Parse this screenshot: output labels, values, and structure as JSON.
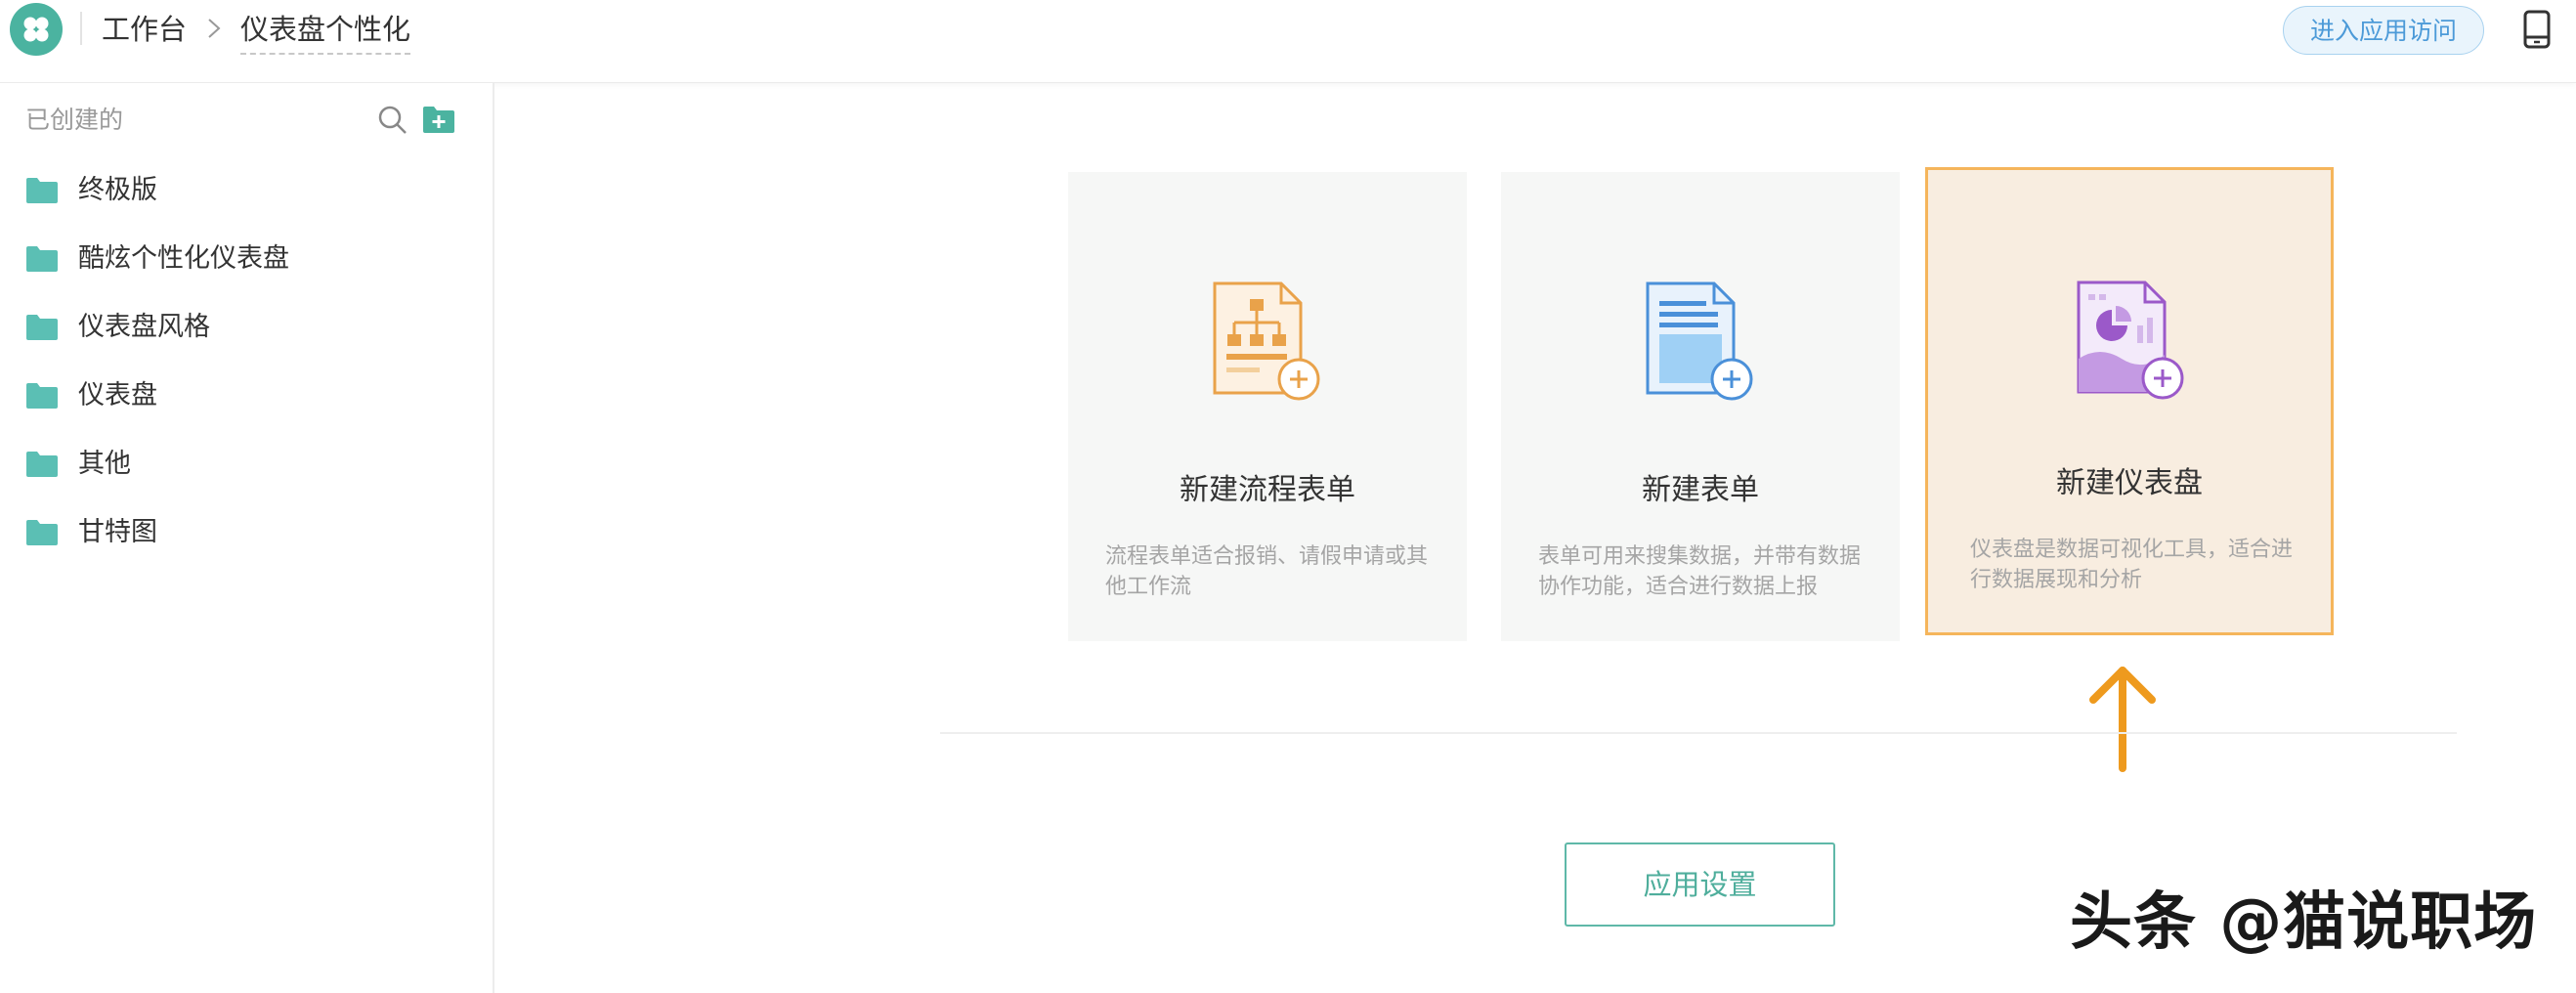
{
  "header": {
    "breadcrumb_root": "工作台",
    "breadcrumb_current": "仪表盘个性化",
    "visit_button_label": "进入应用访问"
  },
  "sidebar": {
    "title": "已创建的",
    "items": [
      {
        "label": "终极版"
      },
      {
        "label": "酷炫个性化仪表盘"
      },
      {
        "label": "仪表盘风格"
      },
      {
        "label": "仪表盘"
      },
      {
        "label": "其他"
      },
      {
        "label": "甘特图"
      }
    ]
  },
  "cards": [
    {
      "title": "新建流程表单",
      "desc": "流程表单适合报销、请假申请或其他工作流"
    },
    {
      "title": "新建表单",
      "desc": "表单可用来搜集数据，并带有数据协作功能，适合进行数据上报"
    },
    {
      "title": "新建仪表盘",
      "desc": "仪表盘是数据可视化工具，适合进行数据展现和分析"
    }
  ],
  "settings_button_label": "应用设置",
  "watermark": "头条 @猫说职场",
  "colors": {
    "brand": "#4bb3a0",
    "accent_orange": "#f5b55b",
    "flow_icon": "#e9a24a",
    "form_icon": "#4a90d9",
    "dashboard_icon": "#9b59c9"
  },
  "icons": [
    "app-logo-icon",
    "chevron-right-icon",
    "mobile-icon",
    "search-icon",
    "add-folder-icon",
    "folder-icon",
    "flow-form-icon",
    "form-icon",
    "dashboard-icon",
    "arrow-up-icon"
  ]
}
